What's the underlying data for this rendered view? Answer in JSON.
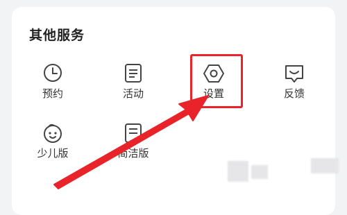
{
  "panel": {
    "title": "其他服务"
  },
  "services": [
    {
      "label": "预约",
      "icon": "clock-icon"
    },
    {
      "label": "活动",
      "icon": "document-icon"
    },
    {
      "label": "设置",
      "icon": "hexagon-settings-icon"
    },
    {
      "label": "反馈",
      "icon": "feedback-icon"
    },
    {
      "label": "少儿版",
      "icon": "child-face-icon"
    },
    {
      "label": "简洁版",
      "icon": "simple-mode-icon"
    }
  ],
  "annotation": {
    "highlight_color": "#e8242a",
    "arrow_color": "#e8242a"
  },
  "colors": {
    "background": "#f2f3f5",
    "card": "#ffffff",
    "text": "#333333",
    "icon_stroke": "#444444"
  }
}
